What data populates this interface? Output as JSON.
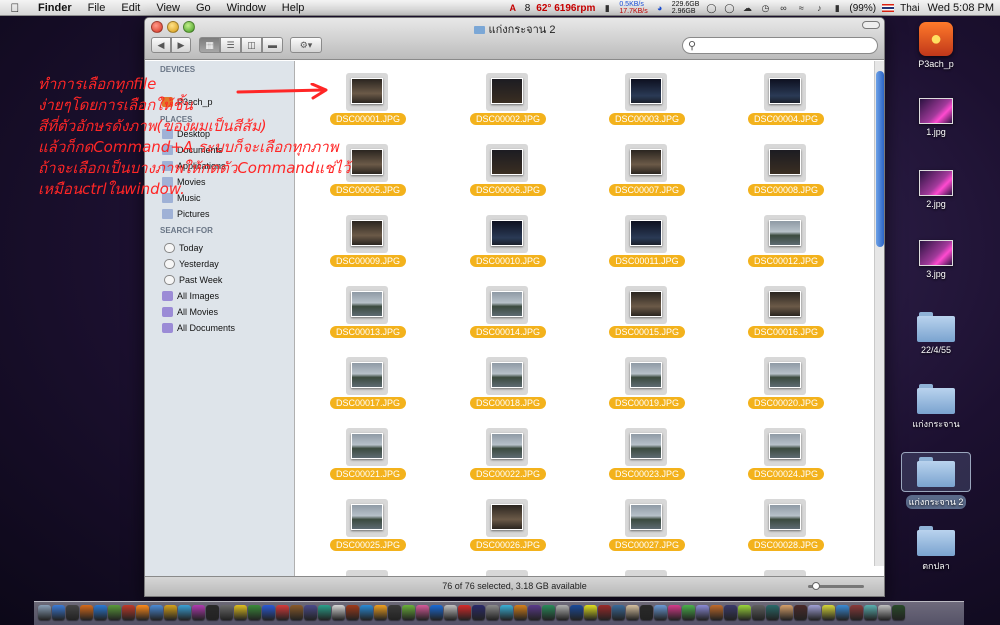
{
  "menubar": {
    "apple": "",
    "items": [
      "Finder",
      "File",
      "Edit",
      "View",
      "Go",
      "Window",
      "Help"
    ],
    "status": {
      "adobe_count": "8",
      "temp_fan": "62° 6196rpm",
      "net_up": "0.5KB/s",
      "net_down": "17.7KB/s",
      "disk_used": "229.6GB",
      "disk_free": "2.96GB",
      "battery": "(99%)",
      "input_lang": "Thai",
      "clock": "Wed 5:08 PM"
    }
  },
  "window": {
    "title": "แก่งกระจาน 2",
    "status_text": "76 of 76 selected, 3.18 GB available"
  },
  "sidebar": {
    "devices_header": "DEVICES",
    "places_header": "PLACES",
    "search_header": "SEARCH FOR",
    "devices": [
      "P3ach_p"
    ],
    "places": [
      "Desktop",
      "Documents",
      "Applications",
      "Movies",
      "Music",
      "Pictures"
    ],
    "search": [
      "Today",
      "Yesterday",
      "Past Week",
      "All Images",
      "All Movies",
      "All Documents"
    ]
  },
  "files": [
    {
      "name": "DSC00001.JPG",
      "tone": "people"
    },
    {
      "name": "DSC00002.JPG",
      "tone": "dark"
    },
    {
      "name": "DSC00003.JPG",
      "tone": "night"
    },
    {
      "name": "DSC00004.JPG",
      "tone": "night"
    },
    {
      "name": "DSC00005.JPG",
      "tone": "people"
    },
    {
      "name": "DSC00006.JPG",
      "tone": "dark"
    },
    {
      "name": "DSC00007.JPG",
      "tone": "people"
    },
    {
      "name": "DSC00008.JPG",
      "tone": "dark"
    },
    {
      "name": "DSC00009.JPG",
      "tone": "people"
    },
    {
      "name": "DSC00010.JPG",
      "tone": "night"
    },
    {
      "name": "DSC00011.JPG",
      "tone": "night"
    },
    {
      "name": "DSC00012.JPG",
      "tone": "lake"
    },
    {
      "name": "DSC00013.JPG",
      "tone": "lake"
    },
    {
      "name": "DSC00014.JPG",
      "tone": "lake"
    },
    {
      "name": "DSC00015.JPG",
      "tone": "people"
    },
    {
      "name": "DSC00016.JPG",
      "tone": "people"
    },
    {
      "name": "DSC00017.JPG",
      "tone": "lake"
    },
    {
      "name": "DSC00018.JPG",
      "tone": "lake"
    },
    {
      "name": "DSC00019.JPG",
      "tone": "lake"
    },
    {
      "name": "DSC00020.JPG",
      "tone": "lake"
    },
    {
      "name": "DSC00021.JPG",
      "tone": "lake"
    },
    {
      "name": "DSC00022.JPG",
      "tone": "lake"
    },
    {
      "name": "DSC00023.JPG",
      "tone": "lake"
    },
    {
      "name": "DSC00024.JPG",
      "tone": "lake"
    },
    {
      "name": "DSC00025.JPG",
      "tone": "lake"
    },
    {
      "name": "DSC00026.JPG",
      "tone": "people"
    },
    {
      "name": "DSC00027.JPG",
      "tone": "lake"
    },
    {
      "name": "DSC00028.JPG",
      "tone": "lake"
    }
  ],
  "annotation": {
    "lines": [
      "ทำการเลือกทุกfile",
      "ง่ายๆโดยการเลือกให้ชิ้น",
      "สีที่ตัวอักษรดังภาพ(ของผมเป็นสีส้ม)",
      "แล้วก็กดCommand+A ระบบก็จะเลือกทุกภาพ",
      "ถ้าจะเลือกเป็นบางภาพให้กดตัวCommandแช่ไว้",
      "เหมือนctrlในwindow."
    ],
    "color": "#ff2626"
  },
  "desktop": {
    "items": [
      {
        "label": "P3ach_p",
        "kind": "app"
      },
      {
        "label": "1.jpg",
        "kind": "jpg"
      },
      {
        "label": "2.jpg",
        "kind": "jpg"
      },
      {
        "label": "3.jpg",
        "kind": "jpg"
      },
      {
        "label": "22/4/55",
        "kind": "folder"
      },
      {
        "label": "แก่งกระจาน",
        "kind": "folder"
      },
      {
        "label": "แก่งกระจาน 2",
        "kind": "folder-selected"
      },
      {
        "label": "ตกปลา",
        "kind": "folder"
      }
    ]
  },
  "colors": {
    "selection_label": "#f3b21c",
    "scroll_thumb": "#2b64c6",
    "sidebar_bg": "#dee4ea"
  },
  "dock": {
    "icon_colors": [
      "#8aa0b8",
      "#3b7bd6",
      "#444",
      "#d66a1a",
      "#2a7ad6",
      "#5a9a3a",
      "#c03a2a",
      "#ff8a1a",
      "#4a8ad6",
      "#d6a21a",
      "#3aa0d6",
      "#b03ab0",
      "#2a2a2a",
      "#6a6a6a",
      "#e0c020",
      "#3a8a3a",
      "#2a5ad6",
      "#d63a3a",
      "#8a5a2a",
      "#4a4a8a",
      "#2aa08a",
      "#d6d6d6",
      "#a03a1a",
      "#2a8ad6",
      "#f0a020",
      "#3a3a3a",
      "#6ab03a",
      "#d65a9a",
      "#1a6ad6",
      "#c0c0c0",
      "#d62a2a",
      "#2a2a6a",
      "#8a8a8a",
      "#3ab0d6",
      "#d6801a",
      "#5a3a8a",
      "#2a8a5a",
      "#b0b0b0",
      "#1a4a9a",
      "#e0e020",
      "#9a2a2a",
      "#3a6a9a",
      "#d6c0a0",
      "#2a2a2a",
      "#6a9ad6",
      "#d63a8a",
      "#4ab04a",
      "#8a8ad6",
      "#c06a2a",
      "#3a3a6a",
      "#9ad63a",
      "#606060",
      "#2a6a6a",
      "#d6a06a",
      "#4a2a2a",
      "#a0a0d6",
      "#d6d63a",
      "#3a8ad6",
      "#8a3a3a",
      "#5ab0b0",
      "#c0c0c0",
      "#2a4a2a"
    ]
  }
}
